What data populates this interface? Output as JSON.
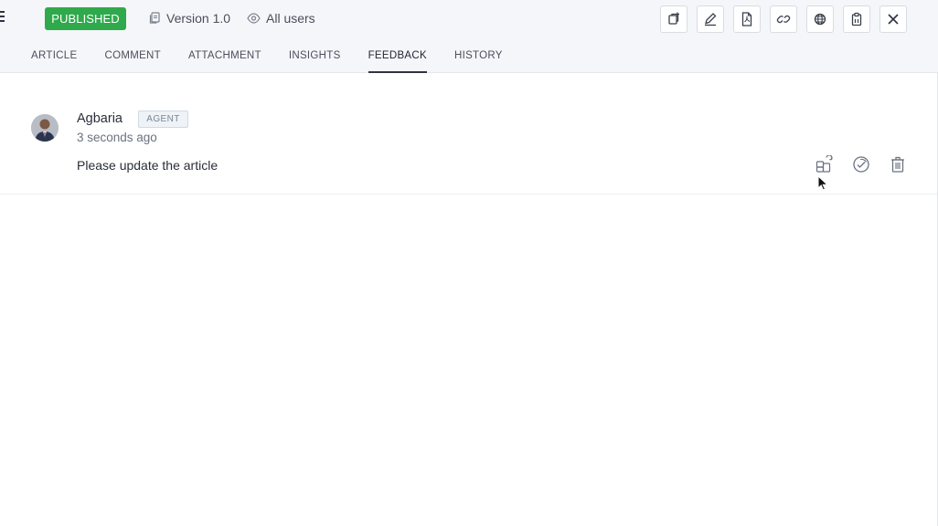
{
  "header": {
    "status": "PUBLISHED",
    "version": "Version 1.0",
    "visibility": "All users",
    "toolbar": [
      {
        "icon": "copy-add-icon"
      },
      {
        "icon": "edit-icon"
      },
      {
        "icon": "pdf-icon"
      },
      {
        "icon": "link-icon"
      },
      {
        "icon": "globe-icon"
      },
      {
        "icon": "clipboard-icon"
      },
      {
        "icon": "close-icon"
      }
    ]
  },
  "tabs": [
    {
      "label": "ARTICLE"
    },
    {
      "label": "COMMENT"
    },
    {
      "label": "ATTACHMENT"
    },
    {
      "label": "INSIGHTS"
    },
    {
      "label": "FEEDBACK",
      "active": true
    },
    {
      "label": "HISTORY"
    }
  ],
  "feedback": {
    "author": "Agbaria",
    "role": "AGENT",
    "time": "3 seconds ago",
    "message": "Please update the article",
    "actions": [
      {
        "icon": "convert-ticket-icon"
      },
      {
        "icon": "resolve-icon"
      },
      {
        "icon": "delete-icon"
      }
    ]
  },
  "colors": {
    "published": "#2eaa4c",
    "header_bg": "#f5f6f9",
    "border": "#d9dce3"
  }
}
